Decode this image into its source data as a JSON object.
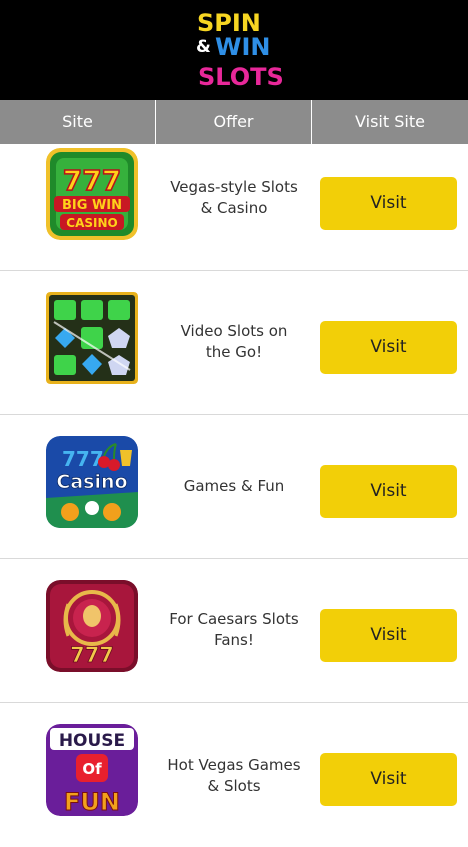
{
  "header": {
    "logo_line1": "SPIN",
    "logo_amp": "&",
    "logo_line2": "WIN",
    "logo_line3": "SLOTS"
  },
  "columns": [
    "Site",
    "Offer",
    "Visit Site"
  ],
  "rows": [
    {
      "icon": "big-win-casino-777-icon",
      "icon_text_top": "777",
      "icon_text_mid": "BIG WIN",
      "icon_text_bottom": "CASINO",
      "offer": "Vegas-style Slots & Casino",
      "button": "Visit"
    },
    {
      "icon": "gem-slots-icon",
      "offer": "Video Slots on the Go!",
      "button": "Visit"
    },
    {
      "icon": "casino-777-cherries-icon",
      "icon_text_top": "777",
      "icon_text_mid": "Casino",
      "offer": "Games & Fun",
      "button": "Visit"
    },
    {
      "icon": "caesars-777-laurel-icon",
      "icon_text_bottom": "777",
      "offer": "For Caesars Slots Fans!",
      "button": "Visit"
    },
    {
      "icon": "house-of-fun-icon",
      "icon_text_top": "HOUSE",
      "icon_text_mid": "Of",
      "icon_text_bottom": "FUN",
      "offer": "Hot Vegas Games & Slots",
      "button": "Visit"
    }
  ],
  "colors": {
    "header_bg": "#000000",
    "column_header_bg": "#8c8c8c",
    "button_bg": "#f2cf08",
    "logo_spin": "#f7d622",
    "logo_win": "#2f8fe6",
    "logo_slots": "#e8289a"
  }
}
